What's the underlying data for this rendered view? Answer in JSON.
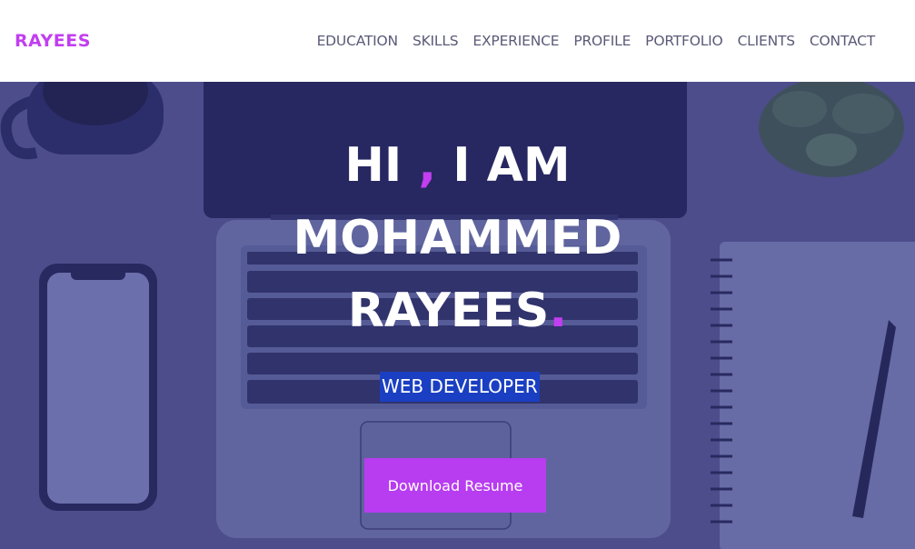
{
  "brand": "RAYEES",
  "nav": [
    {
      "label": "EDUCATION"
    },
    {
      "label": "SKILLS"
    },
    {
      "label": "EXPERIENCE"
    },
    {
      "label": "PROFILE"
    },
    {
      "label": "PORTFOLIO"
    },
    {
      "label": "CLIENTS"
    },
    {
      "label": "CONTACT"
    }
  ],
  "hero": {
    "line1_a": "HI",
    "line1_comma": ",",
    "line1_b": "I AM",
    "line2": "MOHAMMED",
    "line3": "RAYEES",
    "line3_dot": ".",
    "role": "WEB DEVELOPER",
    "download_label": "Download Resume"
  },
  "colors": {
    "brand": "#c23ef0",
    "nav_text": "#5a5a78",
    "overlay": "#4f4f8c",
    "role_bg": "#1a3fc2",
    "button_bg": "#b83cf0"
  }
}
